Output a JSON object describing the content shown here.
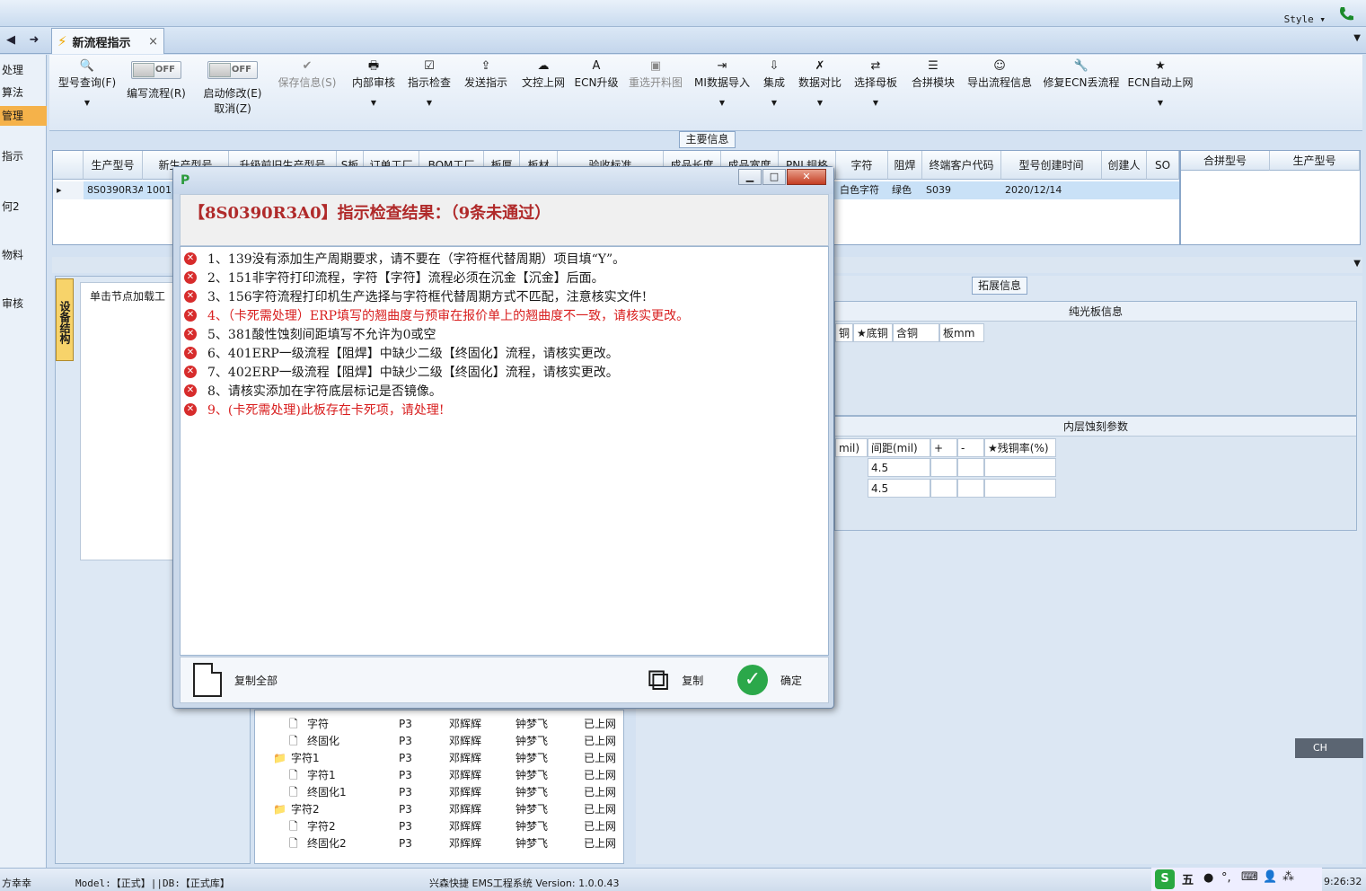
{
  "topbar": {
    "style_label": "Style ▾"
  },
  "tab": {
    "label": "新流程指示",
    "close": "×"
  },
  "sidebar": {
    "items": [
      "处理",
      "算法",
      "管理",
      "指示",
      "何2",
      "物料",
      "审核"
    ]
  },
  "ribbon": {
    "buttons": [
      {
        "label": "型号查询(F)",
        "icon": "🔍"
      },
      {
        "label": "编写流程(R)",
        "toggle": "OFF"
      },
      {
        "label": "启动修改(E)",
        "sub": "取消(Z)",
        "toggle": "OFF"
      },
      {
        "label": "保存信息(S)",
        "icon": "✔"
      },
      {
        "label": "内部审核",
        "icon": "🖶"
      },
      {
        "label": "指示检查",
        "icon": "☑"
      },
      {
        "label": "发送指示",
        "icon": "⇪"
      },
      {
        "label": "文控上网",
        "icon": "☁"
      },
      {
        "label": "ECN升级",
        "icon": "A"
      },
      {
        "label": "重选开料图",
        "icon": "▣"
      },
      {
        "label": "MI数据导入",
        "icon": "⇥"
      },
      {
        "label": "集成",
        "icon": "⇩"
      },
      {
        "label": "数据对比",
        "icon": "✗"
      },
      {
        "label": "选择母板",
        "icon": "⇄"
      },
      {
        "label": "合拼模块",
        "icon": "☰"
      },
      {
        "label": "导出流程信息",
        "icon": "☺"
      },
      {
        "label": "修复ECN丢流程",
        "icon": "🔧"
      },
      {
        "label": "ECN自动上网",
        "icon": "★"
      }
    ]
  },
  "main_info": {
    "label": "主要信息",
    "columns": [
      "生产型号",
      "新生产型号",
      "升级前旧生产型号",
      "S板",
      "订单工厂",
      "BOM工厂",
      "板厚",
      "板材",
      "验收标准",
      "成品长度",
      "成品宽度",
      "PNL规格",
      "字符",
      "阻焊",
      "终端客户代码",
      "型号创建时间",
      "创建人",
      "SO"
    ],
    "row": {
      "model": "8S0390R3A0",
      "new_model": "1001",
      "char": "白色字符",
      "mask": "绿色",
      "cust": "S039",
      "created": "2020/12/14"
    }
  },
  "merge": {
    "columns": [
      "合拼型号",
      "生产型号"
    ]
  },
  "left_panel": {
    "vtab": "设备结构",
    "header": "单击节点加载工"
  },
  "tree": {
    "rows": [
      {
        "name": "字符",
        "a": "P3",
        "b": "邓辉辉",
        "c": "钟梦飞",
        "d": "已上网",
        "folder": false,
        "indent": 2
      },
      {
        "name": "终固化",
        "a": "P3",
        "b": "邓辉辉",
        "c": "钟梦飞",
        "d": "已上网",
        "folder": false,
        "indent": 2
      },
      {
        "name": "字符1",
        "a": "P3",
        "b": "邓辉辉",
        "c": "钟梦飞",
        "d": "已上网",
        "folder": true,
        "indent": 1
      },
      {
        "name": "字符1",
        "a": "P3",
        "b": "邓辉辉",
        "c": "钟梦飞",
        "d": "已上网",
        "folder": false,
        "indent": 2
      },
      {
        "name": "终固化1",
        "a": "P3",
        "b": "邓辉辉",
        "c": "钟梦飞",
        "d": "已上网",
        "folder": false,
        "indent": 2
      },
      {
        "name": "字符2",
        "a": "P3",
        "b": "邓辉辉",
        "c": "钟梦飞",
        "d": "已上网",
        "folder": true,
        "indent": 1
      },
      {
        "name": "字符2",
        "a": "P3",
        "b": "邓辉辉",
        "c": "钟梦飞",
        "d": "已上网",
        "folder": false,
        "indent": 2
      },
      {
        "name": "终固化2",
        "a": "P3",
        "b": "邓辉辉",
        "c": "钟梦飞",
        "d": "已上网",
        "folder": false,
        "indent": 2
      }
    ]
  },
  "ext_info": {
    "label": "拓展信息",
    "pure_title": "纯光板信息",
    "pure_cols": [
      "铜",
      "★底铜",
      "含铜",
      "板mm"
    ],
    "inner_title": "内层蚀刻参数",
    "inner_cols": [
      "mil)",
      "间距(mil)",
      "+",
      "-",
      "★残铜率(%)"
    ],
    "inner_vals": [
      "4.5",
      "4.5"
    ]
  },
  "dialog": {
    "title": "【8S0390R3A0】指示检查结果：（9条未通过）",
    "results": [
      {
        "text": "1、139没有添加生产周期要求，请不要在（字符框代替周期）项目填“Y”。",
        "critical": false
      },
      {
        "text": "2、151非字符打印流程，字符【字符】流程必须在沉金【沉金】后面。",
        "critical": false
      },
      {
        "text": "3、156字符流程打印机生产选择与字符框代替周期方式不匹配，注意核实文件!",
        "critical": false
      },
      {
        "text": "4、（卡死需处理）ERP填写的翘曲度与预审在报价单上的翘曲度不一致，请核实更改。",
        "critical": true
      },
      {
        "text": "5、381酸性蚀刻间距填写不允许为0或空",
        "critical": false
      },
      {
        "text": "6、401ERP一级流程【阻焊】中缺少二级【终固化】流程，请核实更改。",
        "critical": false
      },
      {
        "text": "7、402ERP一级流程【阻焊】中缺少二级【终固化】流程，请核实更改。",
        "critical": false
      },
      {
        "text": "8、请核实添加在字符底层标记是否镜像。",
        "critical": false
      },
      {
        "text": "9、(卡死需处理)此板存在卡死项，请处理!",
        "critical": true
      }
    ],
    "copy_all": "复制全部",
    "copy": "复制",
    "ok": "确定"
  },
  "status": {
    "user": "方幸幸",
    "model": "Model:【正式】||DB:【正式库】",
    "app": "兴森快捷  EMS工程系统  Version: 1.0.0.43",
    "time": "9:26:32",
    "ime": "五",
    "lang": "CH"
  },
  "colors": {
    "critical": "#d81e1e",
    "title": "#b02a2a",
    "selection": "#c9e1f7",
    "accent": "#f5b24a"
  }
}
